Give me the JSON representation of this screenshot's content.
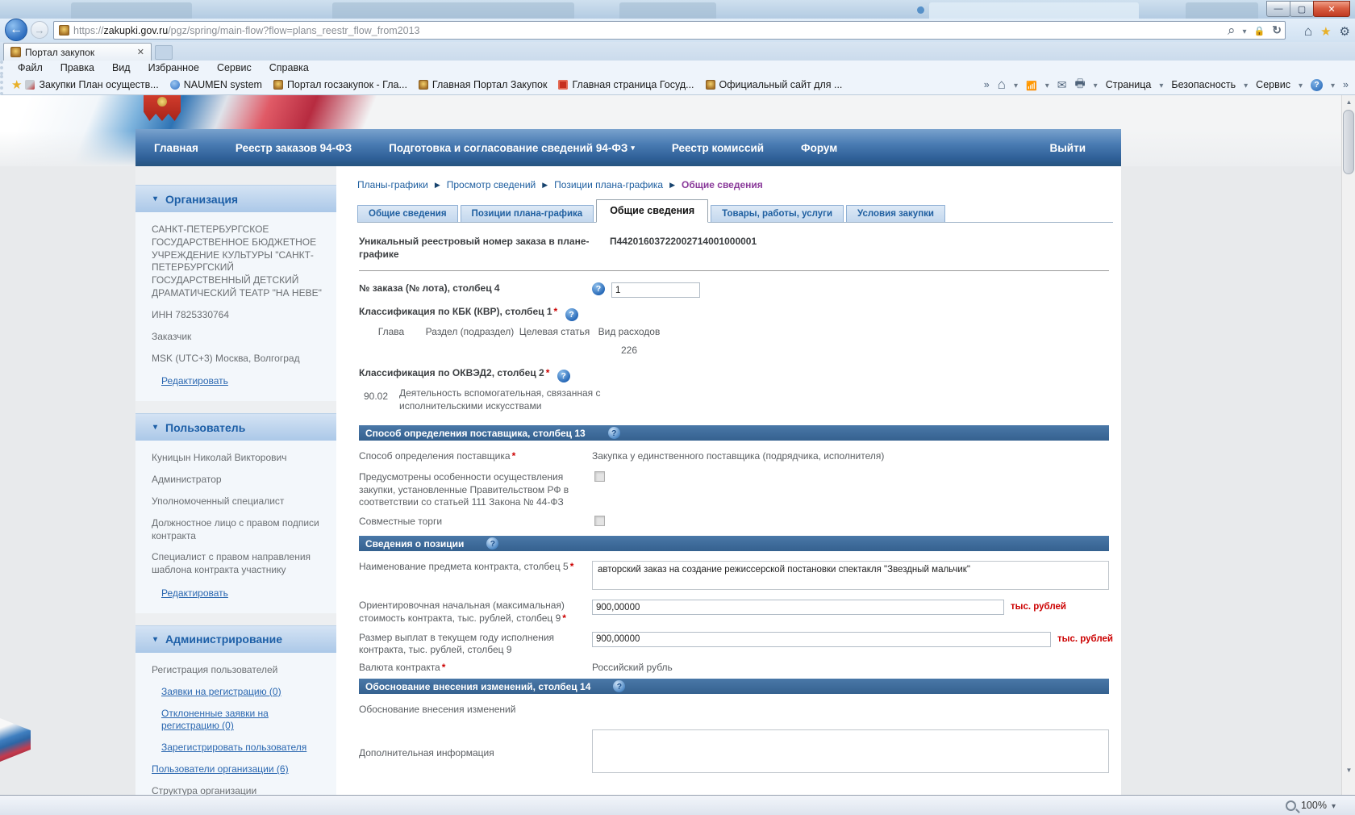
{
  "misc": {
    "req": "*",
    "q": "?"
  },
  "browser": {
    "tab_title": "Портал закупок",
    "tab_close": "✕",
    "url_scheme": "https://",
    "url_domain": "zakupki.gov.ru",
    "url_path": "/pgz/spring/main-flow?flow=plans_reestr_flow_from2013",
    "menu": [
      "Файл",
      "Правка",
      "Вид",
      "Избранное",
      "Сервис",
      "Справка"
    ],
    "favorites": [
      "Закупки  План осуществ...",
      "NAUMEN system",
      "Портал госзакупок - Гла...",
      "Главная Портал Закупок",
      "Главная страница  Госуд...",
      "Официальный сайт для ..."
    ],
    "cmd": {
      "page": "Страница",
      "security": "Безопасность",
      "tools": "Сервис",
      "overflow": "»"
    },
    "win": {
      "min": "—",
      "max": "▢",
      "close": "✕"
    },
    "status_zoom": "100%"
  },
  "nav": {
    "items": [
      "Главная",
      "Реестр заказов 94-ФЗ",
      "Подготовка и согласование сведений 94-ФЗ",
      "Реестр комиссий",
      "Форум"
    ],
    "logout": "Выйти"
  },
  "sidebar": {
    "org": {
      "title": "Организация",
      "name": "САНКТ-ПЕТЕРБУРГСКОЕ ГОСУДАРСТВЕННОЕ БЮДЖЕТНОЕ УЧРЕЖДЕНИЕ КУЛЬТУРЫ \"САНКТ-ПЕТЕРБУРГСКИЙ ГОСУДАРСТВЕННЫЙ ДЕТСКИЙ ДРАМАТИЧЕСКИЙ ТЕАТР \"НА НЕВЕ\"",
      "inn": "ИНН 7825330764",
      "role": "Заказчик",
      "tz": "MSK (UTC+3) Москва, Волгоград",
      "edit": "Редактировать"
    },
    "user": {
      "title": "Пользователь",
      "name": "Куницын Николай Викторович",
      "roles": [
        "Администратор",
        "Уполномоченный специалист",
        "Должностное лицо с правом подписи контракта",
        "Специалист с правом направления шаблона контракта участнику"
      ],
      "edit": "Редактировать"
    },
    "admin": {
      "title": "Администрирование",
      "group": "Регистрация пользователей",
      "links": [
        "Заявки на регистрацию (0)",
        "Отклоненные заявки на регистрацию (0)",
        "Зарегистрировать пользователя",
        "Пользователи организации (6)",
        "Структура организации"
      ]
    }
  },
  "crumbs": [
    "Планы-графики",
    "Просмотр сведений",
    "Позиции плана-графика",
    "Общие сведения"
  ],
  "tabs": [
    "Общие сведения",
    "Позиции плана-графика",
    "Общие сведения",
    "Товары, работы, услуги",
    "Условия закупки"
  ],
  "form": {
    "regnum_label": "Уникальный реестровый номер заказа в плане-графике",
    "regnum_value": "П44201603722002714001000001",
    "order_label": "№ заказа (№ лота), столбец 4",
    "order_value": "1",
    "kbk_label": "Классификация по КБК (КВР), столбец 1",
    "kbk_cols": [
      "Глава",
      "Раздел (подраздел)",
      "Целевая статья",
      "Вид расходов"
    ],
    "kbk_value": "226",
    "okved_label": "Классификация по ОКВЭД2, столбец 2",
    "okved_code": "90.02",
    "okved_desc": "Деятельность вспомогательная, связанная с исполнительскими искусствами",
    "sec1_title": "Способ определения поставщика, столбец 13",
    "method_label": "Способ определения поставщика",
    "method_value": "Закупка у единственного поставщика (подрядчика, исполнителя)",
    "feat_label": "Предусмотрены особенности осуществления закупки, установленные Правительством РФ в соответствии  со статьей 111 Закона № 44-ФЗ",
    "joint_label": "Совместные торги",
    "sec2_title": "Сведения о позиции",
    "subject_label": "Наименование предмета контракта, столбец 5",
    "subject_value": "авторский заказ на создание режиссерской постановки спектакля \"Звездный мальчик\"",
    "maxprice_label": "Ориентировочная начальная (максимальная) стоимость контракта, тыс. рублей, столбец 9",
    "maxprice_value": "900,00000",
    "unit": "тыс. рублей",
    "payments_label": "Размер выплат в текущем году исполнения контракта, тыс. рублей, столбец 9",
    "payments_value": "900,00000",
    "currency_label": "Валюта контракта",
    "currency_value": "Российский рубль",
    "sec3_title": "Обоснование внесения изменений, столбец 14",
    "justify_label": "Обоснование внесения изменений",
    "addinfo_label": "Дополнительная информация"
  }
}
